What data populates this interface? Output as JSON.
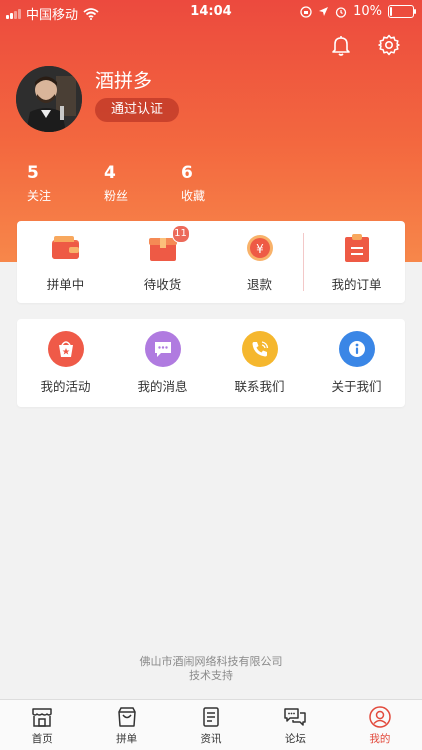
{
  "status_bar": {
    "carrier": "中国移动",
    "time": "14:04",
    "battery": "10%",
    "battery_level": 0.1
  },
  "profile": {
    "name": "酒拼多",
    "certification": "通过认证"
  },
  "stats": [
    {
      "value": "5",
      "label": "关注"
    },
    {
      "value": "4",
      "label": "粉丝"
    },
    {
      "value": "6",
      "label": "收藏"
    }
  ],
  "orders": [
    {
      "label": "拼单中",
      "icon": "wallet-icon"
    },
    {
      "label": "待收货",
      "icon": "package-icon",
      "badge": "11"
    },
    {
      "label": "退款",
      "icon": "refund-icon"
    },
    {
      "label": "我的订单",
      "icon": "clipboard-icon"
    }
  ],
  "tools": [
    {
      "label": "我的活动",
      "icon": "activity-icon",
      "color": "#ef5a48"
    },
    {
      "label": "我的消息",
      "icon": "message-icon",
      "color": "#b07be0"
    },
    {
      "label": "联系我们",
      "icon": "phone-icon",
      "color": "#f5b72e"
    },
    {
      "label": "关于我们",
      "icon": "info-icon",
      "color": "#3a86e6"
    }
  ],
  "footer": {
    "company": "佛山市酒闹网络科技有限公司",
    "support": "技术支持"
  },
  "tabs": [
    {
      "label": "首页",
      "icon": "home-icon"
    },
    {
      "label": "拼单",
      "icon": "bag-icon"
    },
    {
      "label": "资讯",
      "icon": "news-icon"
    },
    {
      "label": "论坛",
      "icon": "chat-icon"
    },
    {
      "label": "我的",
      "icon": "user-icon",
      "active": true
    }
  ],
  "colors": {
    "brand": "#ec4a3e",
    "active_tab": "#e24a3c"
  }
}
